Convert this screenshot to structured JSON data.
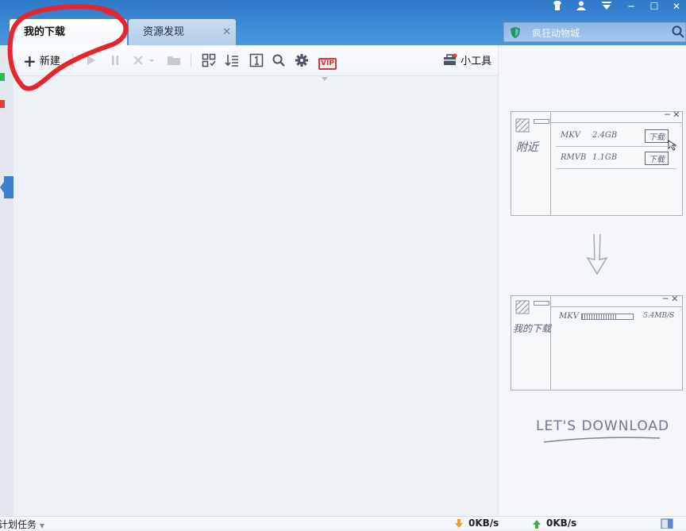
{
  "window_controls": {
    "skin": "shirt-icon",
    "account": "user-icon",
    "menu": "menu-icon",
    "minimize": "─",
    "maximize": "☐",
    "close": "✕"
  },
  "tabs": [
    {
      "label": "我的下载",
      "active": true
    },
    {
      "label": "资源发现",
      "active": false,
      "close": "✕"
    }
  ],
  "search": {
    "placeholder": "疯狂动物城"
  },
  "toolbar": {
    "new_label": "新建",
    "new_icon": "+",
    "tools_label": "小工具",
    "vip_label": "VIP"
  },
  "right_panel": {
    "sketch1": {
      "side_label": "附近",
      "rows": [
        {
          "format": "MKV",
          "size": "2.4GB",
          "button": "下载"
        },
        {
          "format": "RMVB",
          "size": "1.1GB",
          "button": "下载"
        }
      ]
    },
    "sketch2": {
      "side_label": "我的下载",
      "row": {
        "format": "MKV",
        "speed": "5.4MB/S",
        "progress": 0.7
      }
    },
    "tagline": "LET'S DOWNLOAD"
  },
  "statusbar": {
    "planned_tasks": "计划任务",
    "download_speed": "0KB/s",
    "upload_speed": "0KB/s"
  },
  "colors": {
    "accent": "#3d8ad6",
    "annotation": "#e8252a"
  }
}
